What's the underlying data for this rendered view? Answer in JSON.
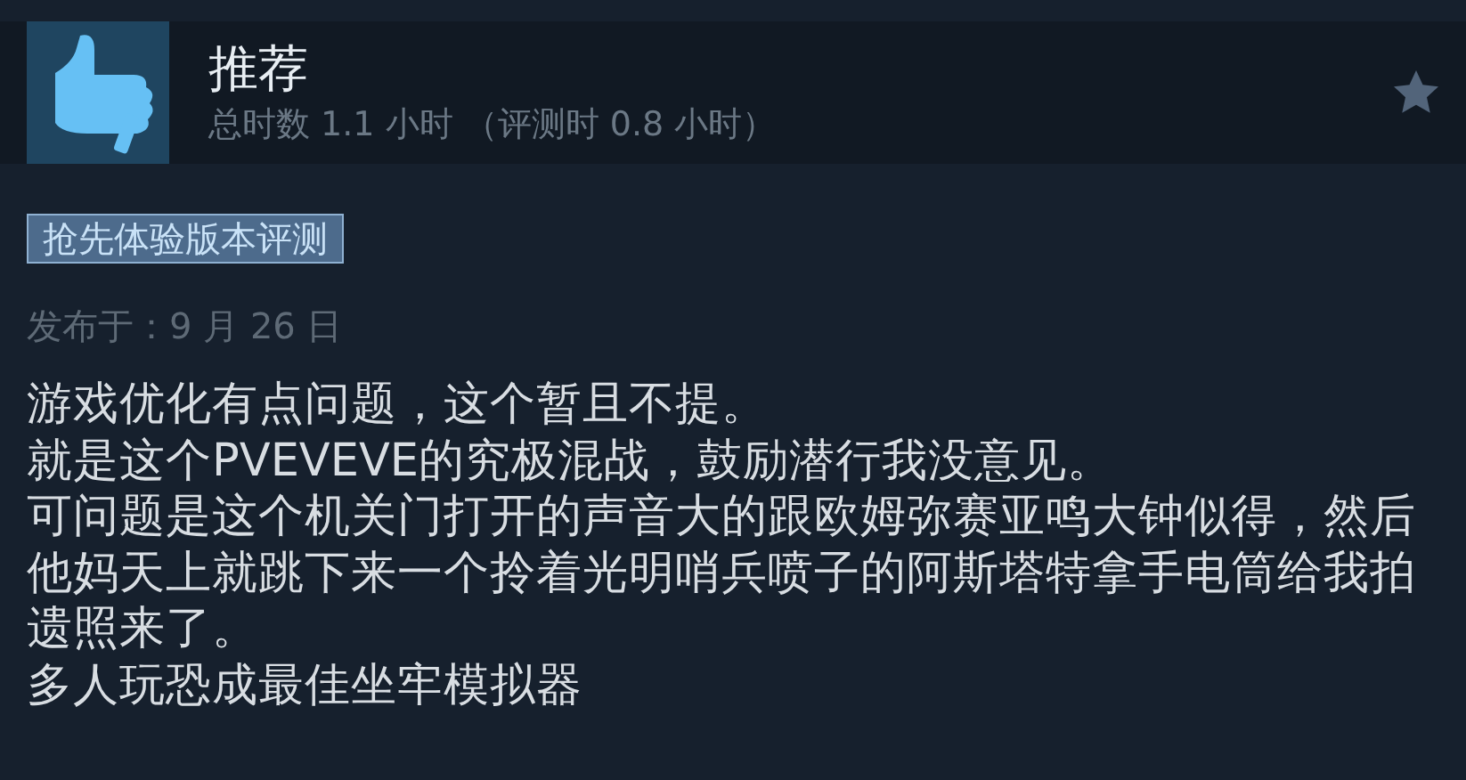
{
  "review": {
    "verdict": "推荐",
    "hours": "总时数 1.1 小时 （评测时 0.8 小时）",
    "badge": "抢先体验版本评测",
    "posted": "发布于：9 月 26 日",
    "paragraphs": [
      "游戏优化有点问题，这个暂且不提。",
      "就是这个PVEVEVE的究极混战，鼓励潜行我没意见。",
      "可问题是这个机关门打开的声音大的跟欧姆弥赛亚鸣大钟似得，然后他妈天上就跳下来一个拎着光明哨兵喷子的阿斯塔特拿手电筒给我拍遗照来了。",
      "多人玩恐成最佳坐牢模拟器"
    ]
  }
}
